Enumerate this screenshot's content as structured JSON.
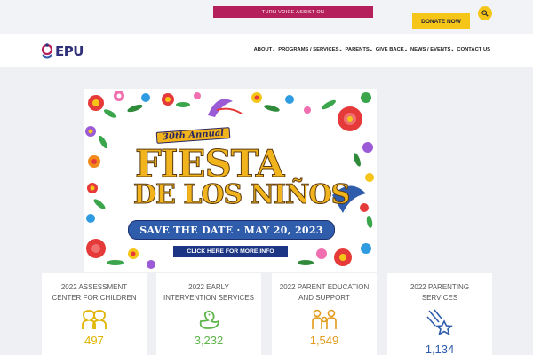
{
  "topbar": {
    "voice_assist_label": "TURN VOICE ASSIST ON",
    "donate_label": "DONATE NOW",
    "search_icon": "search-icon"
  },
  "brand": {
    "logo_text": "EPU",
    "colors": {
      "primary": "#2f2f7a",
      "accent": "#b51f5b",
      "yellow": "#f5c518"
    }
  },
  "nav": {
    "items": [
      {
        "label": "ABOUT",
        "has_dropdown": true
      },
      {
        "label": "PROGRAMS / SERVICES",
        "has_dropdown": true
      },
      {
        "label": "PARENTS",
        "has_dropdown": true
      },
      {
        "label": "GIVE BACK",
        "has_dropdown": true
      },
      {
        "label": "NEWS / EVENTS",
        "has_dropdown": true
      },
      {
        "label": "CONTACT US",
        "has_dropdown": false
      }
    ]
  },
  "banner": {
    "annual": "30th Annual",
    "line1": "FIESTA",
    "line2": "DE LOS NIÑOS",
    "save_the_date": "SAVE THE DATE · MAY 20, 2023",
    "cta": "CLICK HERE FOR MORE INFO"
  },
  "stats": [
    {
      "title": "2022 ASSESSMENT CENTER FOR CHILDREN",
      "value": "497",
      "color": "#e0b400",
      "icon": "people-icon"
    },
    {
      "title": "2022 EARLY INTERVENTION SERVICES",
      "value": "3,232",
      "color": "#5fb54a",
      "icon": "duck-icon"
    },
    {
      "title": "2022 PARENT EDUCATION AND SUPPORT",
      "value": "1,549",
      "color": "#e39a1a",
      "icon": "family-icon"
    },
    {
      "title": "2022 PARENTING SERVICES",
      "value": "1,134",
      "color": "#2f5dab",
      "icon": "shooting-star-icon"
    }
  ]
}
